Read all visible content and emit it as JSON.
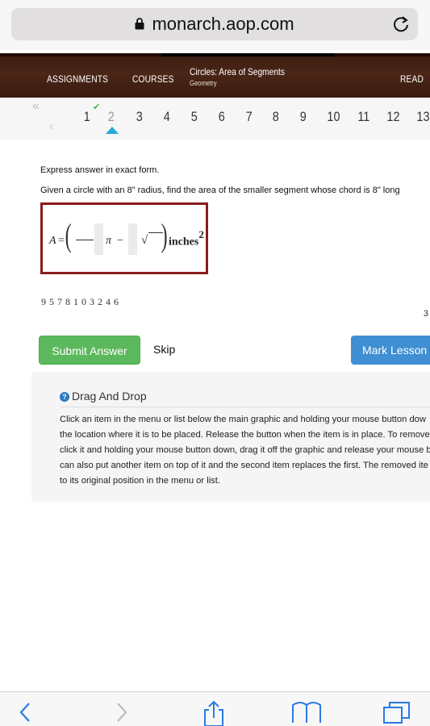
{
  "browser": {
    "url": "monarch.aop.com",
    "lock_icon": "lock-icon",
    "reload_icon": "reload-icon"
  },
  "header": {
    "nav_assignments": "ASSIGNMENTS",
    "nav_courses": "COURSES",
    "course_title": "Circles: Area of Segments",
    "course_subtitle": "Geometry",
    "nav_read": "READ"
  },
  "pager": {
    "first_icon": "double-chevron-left-icon",
    "prev_icon": "chevron-left-icon",
    "pages": [
      "1",
      "2",
      "3",
      "4",
      "5",
      "6",
      "7",
      "8",
      "9",
      "10",
      "11",
      "12",
      "13"
    ],
    "current": "2",
    "completed": [
      "1"
    ]
  },
  "question": {
    "instruction": "Express answer in exact form.",
    "text": "Given a circle with an 8\" radius, find the area of the smaller segment whose chord is 8\" long",
    "formula": {
      "lhs": "A",
      "equals": "=",
      "pi": "π",
      "minus": "−",
      "sqrt": "√",
      "units": "inches",
      "exponent": "2"
    },
    "tokens": [
      "9",
      "5",
      "7",
      "8",
      "1",
      "0",
      "3",
      "2",
      "4",
      "6"
    ],
    "page_count": "3"
  },
  "actions": {
    "submit": "Submit Answer",
    "skip": "Skip",
    "mark": "Mark Lesson"
  },
  "help": {
    "title": "Drag And Drop",
    "lines": [
      "Click an item in the menu or list below the main graphic and holding your mouse button dow",
      "the location where it is to be placed. Release the button when the item is in place. To remove",
      "click it and holding your mouse button down, drag it off the graphic and release your mouse b",
      "can also put another item on top of it and the second item replaces the first. The removed ite",
      "to its original position in the menu or list."
    ]
  },
  "toolbar": {
    "back_icon": "back-arrow-icon",
    "forward_icon": "forward-arrow-icon",
    "share_icon": "share-icon",
    "bookmarks_icon": "bookmarks-icon",
    "tabs_icon": "tabs-icon"
  }
}
